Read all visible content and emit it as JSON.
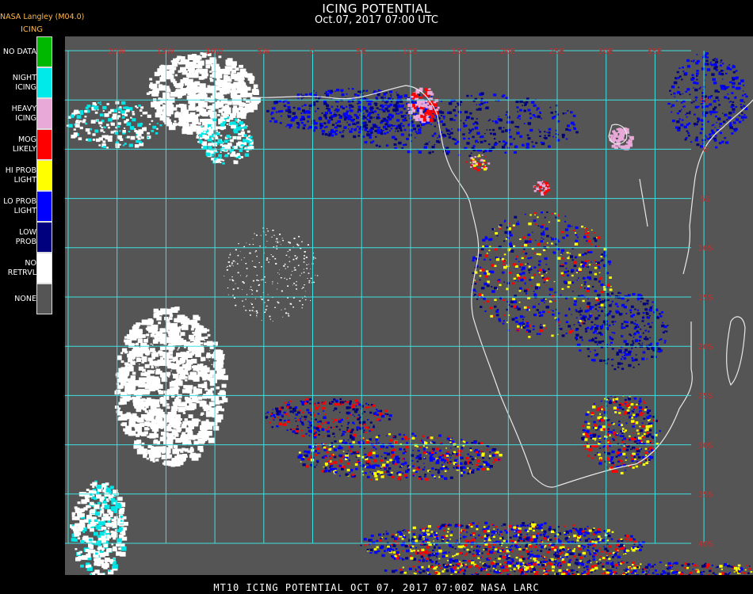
{
  "header": {
    "title": "ICING POTENTIAL",
    "subtitle": "Oct.07, 2017 07:00 UTC",
    "provider": "NASA Langley (M04.0)",
    "product": "ICING"
  },
  "legend": [
    {
      "label": "NO DATA",
      "color": "#00b800"
    },
    {
      "label": "NIGHT\nICING",
      "color": "#00eaea"
    },
    {
      "label": "HEAVY\nICING",
      "color": "#e8a8d8"
    },
    {
      "label": "MOG\nLIKELY",
      "color": "#ff0000"
    },
    {
      "label": "HI PROB\nLIGHT",
      "color": "#ffff00"
    },
    {
      "label": "LO PROB\nLIGHT",
      "color": "#0000ff"
    },
    {
      "label": "LOW\nPROB",
      "color": "#00007f"
    },
    {
      "label": "NO\nRETRVL",
      "color": "#ffffff"
    },
    {
      "label": "NONE",
      "color": "#555555"
    }
  ],
  "map": {
    "background_color": "#555555",
    "grid_color": "#3fe0e0",
    "label_color": "#c03030",
    "lon_labels": [
      "20W",
      "15W",
      "10W",
      "5W",
      "0",
      "5E",
      "10E",
      "15E",
      "20E",
      "25E",
      "30E",
      "35E"
    ],
    "lat_labels": [
      "5N",
      "0",
      "5S",
      "10S",
      "15S",
      "20S",
      "25S",
      "30S",
      "35S",
      "40S"
    ]
  },
  "footer": "MT10  ICING POTENTIAL   OCT 07, 2017 07:00Z   NASA LARC"
}
